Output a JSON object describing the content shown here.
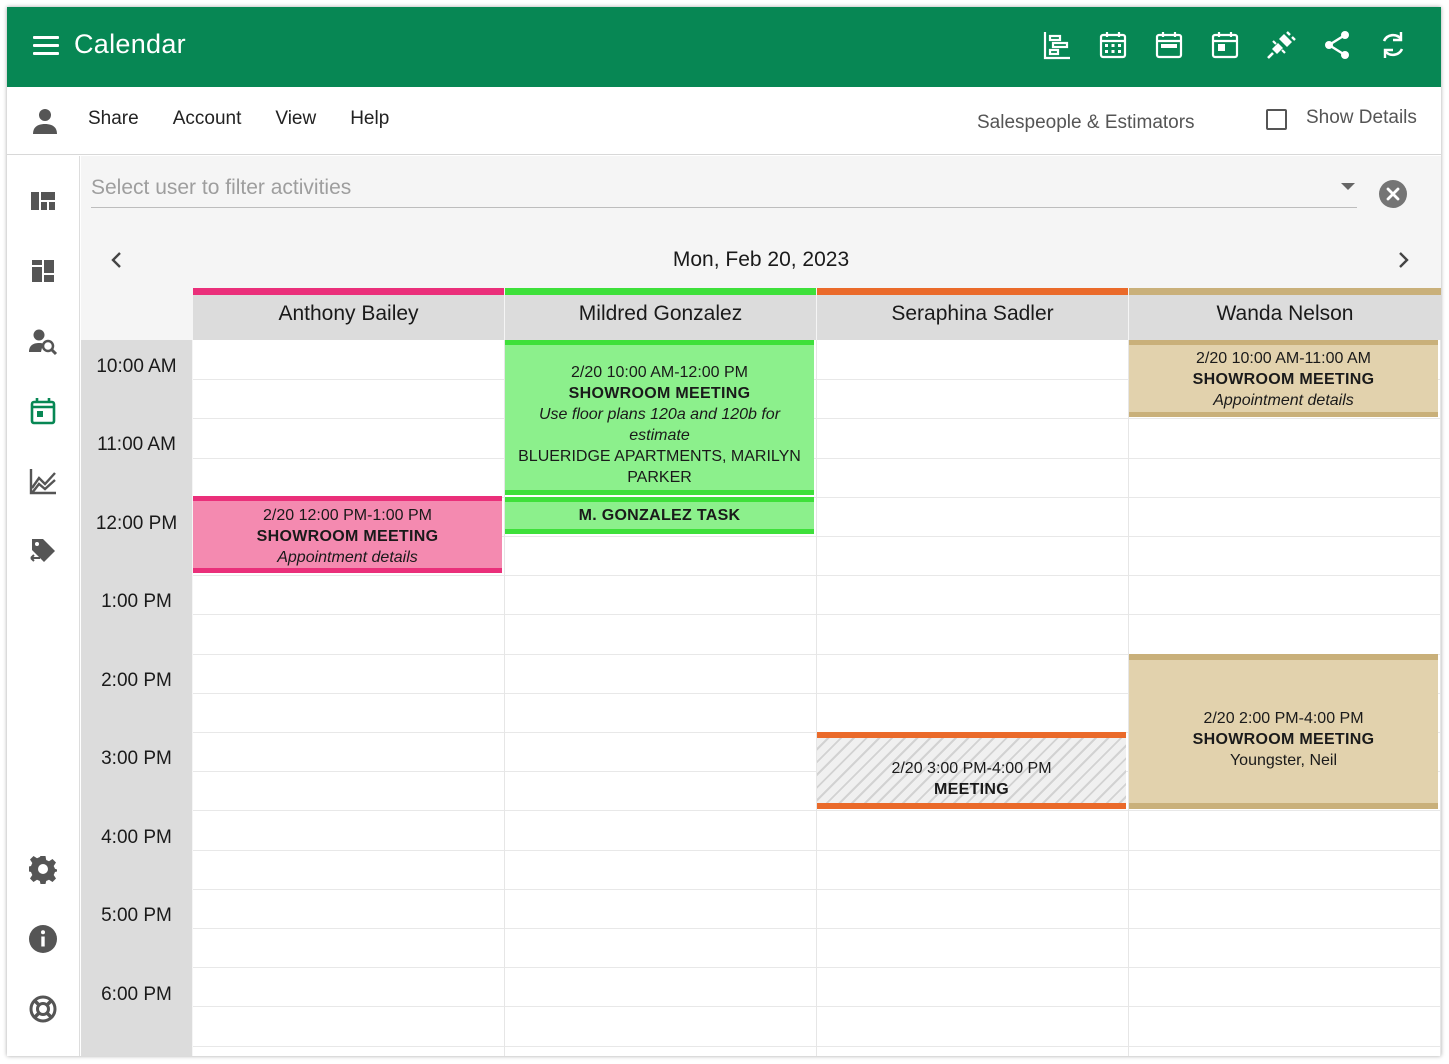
{
  "app": {
    "title": "Calendar"
  },
  "appbar_icons": [
    "gantt-icon",
    "month-view-icon",
    "week-view-icon",
    "day-view-icon",
    "plugin-icon",
    "share-icon",
    "sync-icon"
  ],
  "menu": {
    "items": [
      "Share",
      "Account",
      "View",
      "Help"
    ],
    "group": "Salespeople & Estimators",
    "show_details": "Show Details"
  },
  "filter": {
    "placeholder": "Select user to filter activities"
  },
  "date_title": "Mon, Feb 20, 2023",
  "times": [
    "10:00 AM",
    "11:00 AM",
    "12:00 PM",
    "1:00 PM",
    "2:00 PM",
    "3:00 PM",
    "4:00 PM",
    "5:00 PM",
    "6:00 PM"
  ],
  "resources": [
    {
      "name": "Anthony Bailey",
      "color": "#ea2f7a"
    },
    {
      "name": "Mildred Gonzalez",
      "color": "#3ee03a"
    },
    {
      "name": "Seraphina Sadler",
      "color": "#ea6a2a"
    },
    {
      "name": "Wanda Nelson",
      "color": "#c9b07a"
    }
  ],
  "events": {
    "ab1": {
      "time": "2/20 12:00 PM-1:00 PM",
      "title": "SHOWROOM MEETING",
      "note": "Appointment details"
    },
    "mg1": {
      "time": "2/20 10:00 AM-12:00 PM",
      "title": "SHOWROOM MEETING",
      "note": "Use floor plans 120a and 120b for estimate",
      "extra": "BLUERIDGE APARTMENTS, MARILYN PARKER"
    },
    "mg2": {
      "title": "M. GONZALEZ TASK"
    },
    "ss1": {
      "time": "2/20 3:00 PM-4:00 PM",
      "title": "MEETING"
    },
    "wn1": {
      "time": "2/20 10:00 AM-11:00 AM",
      "title": "SHOWROOM MEETING",
      "note": "Appointment details"
    },
    "wn2": {
      "time": "2/20 2:00 PM-4:00 PM",
      "title": "SHOWROOM MEETING",
      "extra": "Youngster, Neil"
    }
  },
  "colors": {
    "appbar": "#078754",
    "pink_fill": "#f48ab0",
    "green_fill": "#8cf08c",
    "tan_fill": "#e2d2ad"
  }
}
